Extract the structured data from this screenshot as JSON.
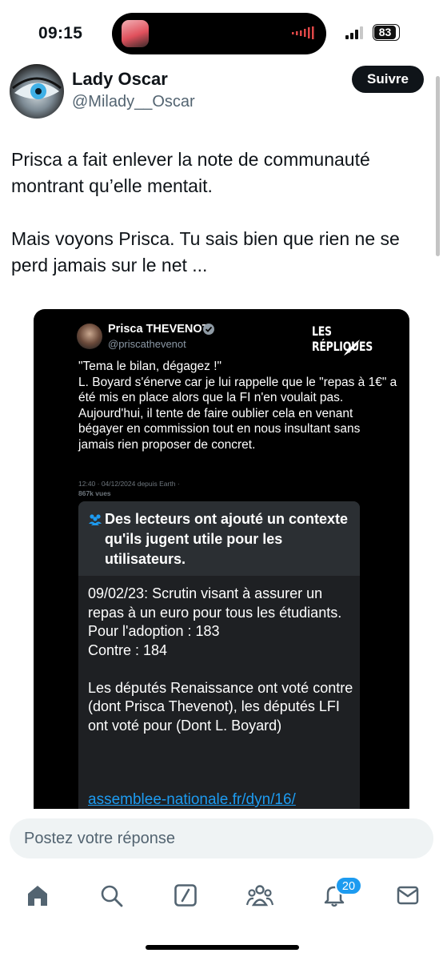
{
  "status_bar": {
    "time": "09:15",
    "battery": "83"
  },
  "author": {
    "name": "Lady Oscar",
    "handle": "@Milady__Oscar",
    "follow_label": "Suivre"
  },
  "tweet": {
    "paragraph1": "Prisca a fait enlever la note de communauté montrant qu’elle mentait.",
    "paragraph2": "Mais voyons Prisca. Tu sais bien que rien ne se perd jamais sur le net ..."
  },
  "embedded": {
    "name": "Prisca THEVENOT",
    "handle": "@priscathevenot",
    "brand": "LES RÉPLIQUES",
    "body": "\"Tema le bilan, dégagez !\"\nL. Boyard s'énerve car je lui rappelle que le \"repas à 1€\" a été mis en place alors que la FI n'en voulait pas.\nAujourd'hui, il tente de faire oublier cela en venant bégayer en commission tout en nous insultant sans jamais rien proposer de concret.",
    "meta": "12:40 · 04/12/2024 depuis Earth ·",
    "views": "867k vues",
    "note_title": "Des lecteurs ont ajouté un contexte qu'ils jugent utile pour les utilisateurs.",
    "note_body": "09/02/23: Scrutin visant à assurer un repas à un euro pour tous les étudiants.\nPour l'adoption : 183\nContre : 184\n\nLes députés Renaissance ont voté contre (dont Prisca Thevenot), les députés LFI ont voté pour (Dont L. Boyard)",
    "note_link": "assemblee-nationale.fr/dyn/16/"
  },
  "reply": {
    "placeholder": "Postez votre réponse"
  },
  "tabbar": {
    "items": [
      "home-icon",
      "search-icon",
      "grok-icon",
      "communities-icon",
      "notifications-icon",
      "messages-icon"
    ],
    "notifications_badge": "20"
  },
  "colors": {
    "accent": "#1d9bf0",
    "text": "#0f1419",
    "secondary": "#536471"
  }
}
